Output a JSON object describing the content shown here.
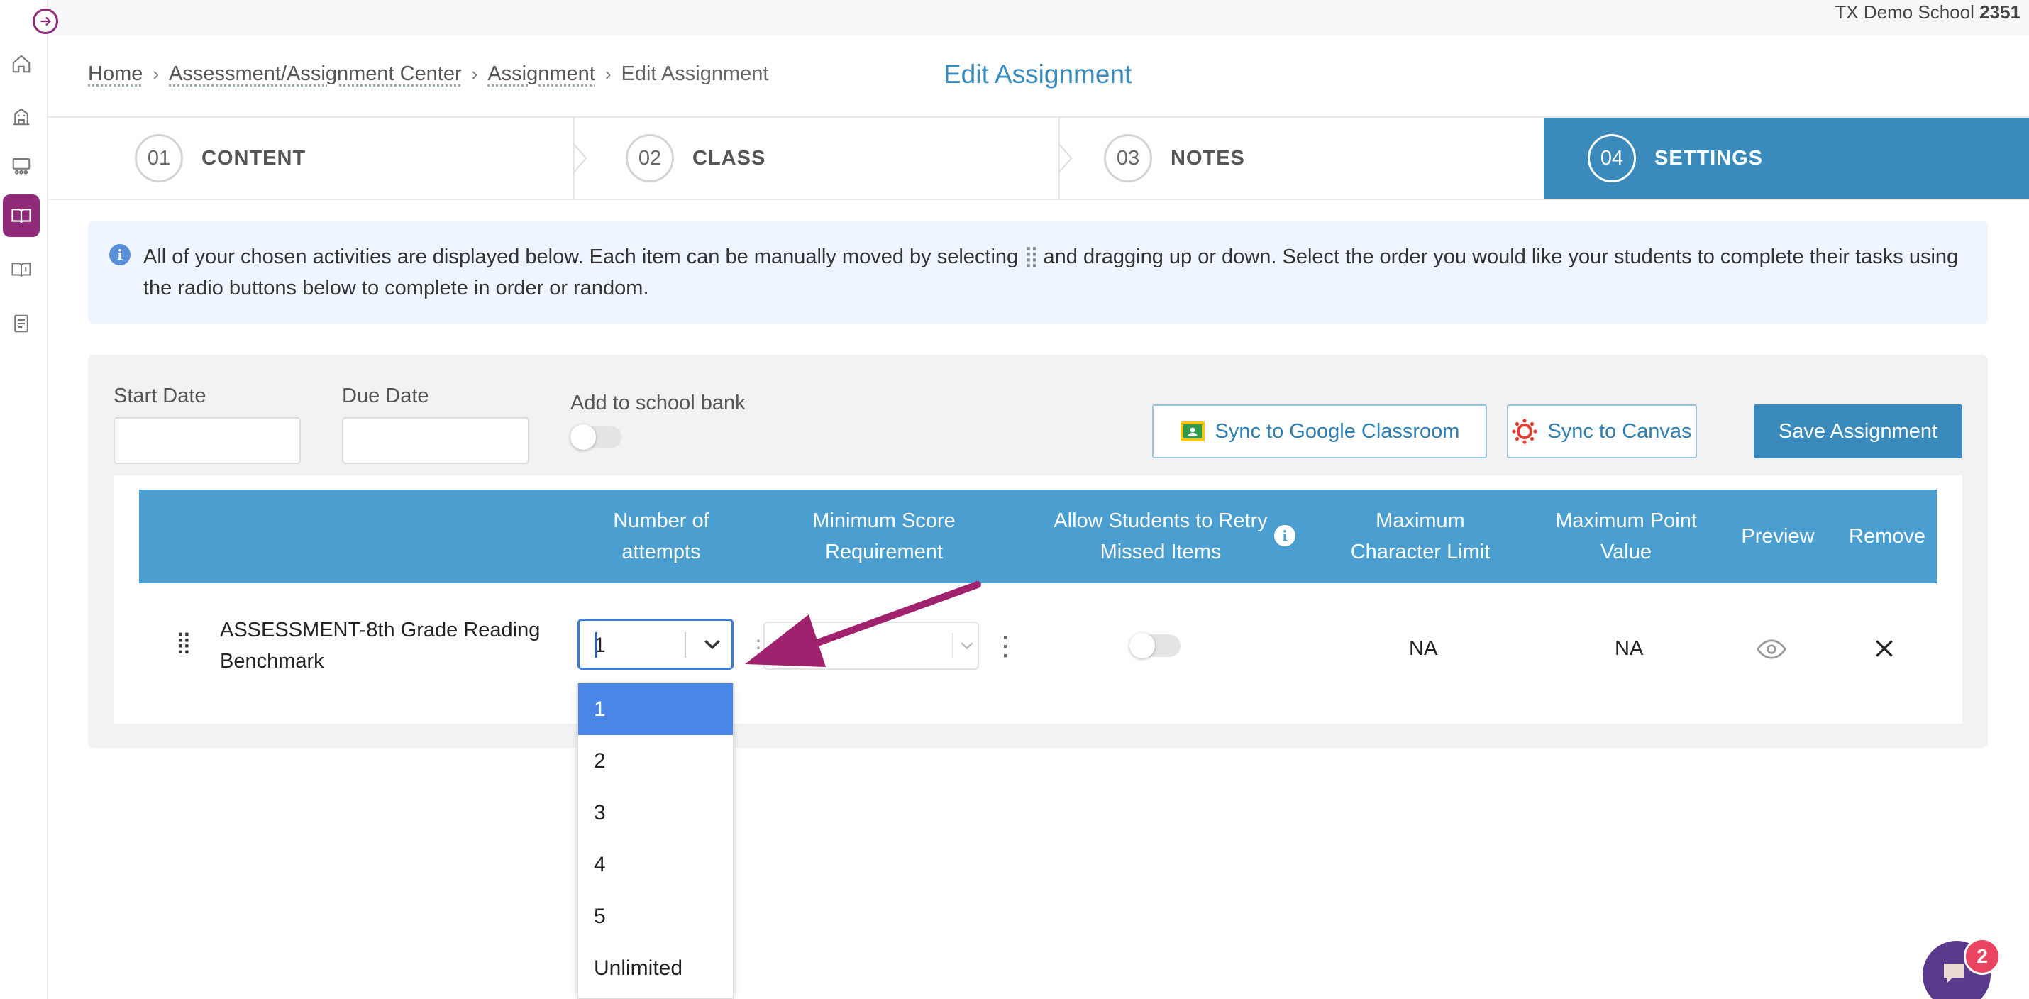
{
  "school": {
    "name": "TX Demo School",
    "code": "2351"
  },
  "breadcrumb": {
    "home": "Home",
    "center": "Assessment/Assignment Center",
    "assignment": "Assignment",
    "current": "Edit Assignment"
  },
  "page_title": "Edit Assignment",
  "steps": [
    {
      "num": "01",
      "label": "CONTENT"
    },
    {
      "num": "02",
      "label": "CLASS"
    },
    {
      "num": "03",
      "label": "NOTES"
    },
    {
      "num": "04",
      "label": "SETTINGS"
    }
  ],
  "info": {
    "text_part1": "All of your chosen activities are displayed below. Each item can be manually moved by selecting",
    "text_part2": "and dragging up or down. Select the order you would like your students to complete their tasks using the radio buttons below to complete in order or random."
  },
  "form": {
    "start_date_label": "Start Date",
    "due_date_label": "Due Date",
    "school_bank_label": "Add to school bank",
    "start_date_value": "",
    "due_date_value": ""
  },
  "buttons": {
    "google": "Sync to Google Classroom",
    "canvas": "Sync to Canvas",
    "save": "Save Assignment"
  },
  "table": {
    "headers": {
      "attempts_l1": "Number of",
      "attempts_l2": "attempts",
      "min_score_l1": "Minimum Score",
      "min_score_l2": "Requirement",
      "retry_l1": "Allow Students to Retry",
      "retry_l2": "Missed Items",
      "max_char_l1": "Maximum",
      "max_char_l2": "Character Limit",
      "max_point_l1": "Maximum Point",
      "max_point_l2": "Value",
      "preview": "Preview",
      "remove": "Remove"
    },
    "row": {
      "title_l1": "ASSESSMENT-8th Grade Reading",
      "title_l2": "Benchmark",
      "attempts_value": "1",
      "max_char": "NA",
      "max_point": "NA"
    }
  },
  "dropdown_options": [
    "1",
    "2",
    "3",
    "4",
    "5",
    "Unlimited"
  ],
  "chat_badge": "2",
  "colors": {
    "primary": "#3a8bbb",
    "accent": "#8e2a78",
    "annotation_arrow": "#a0226e",
    "header": "#4a9fd0"
  }
}
